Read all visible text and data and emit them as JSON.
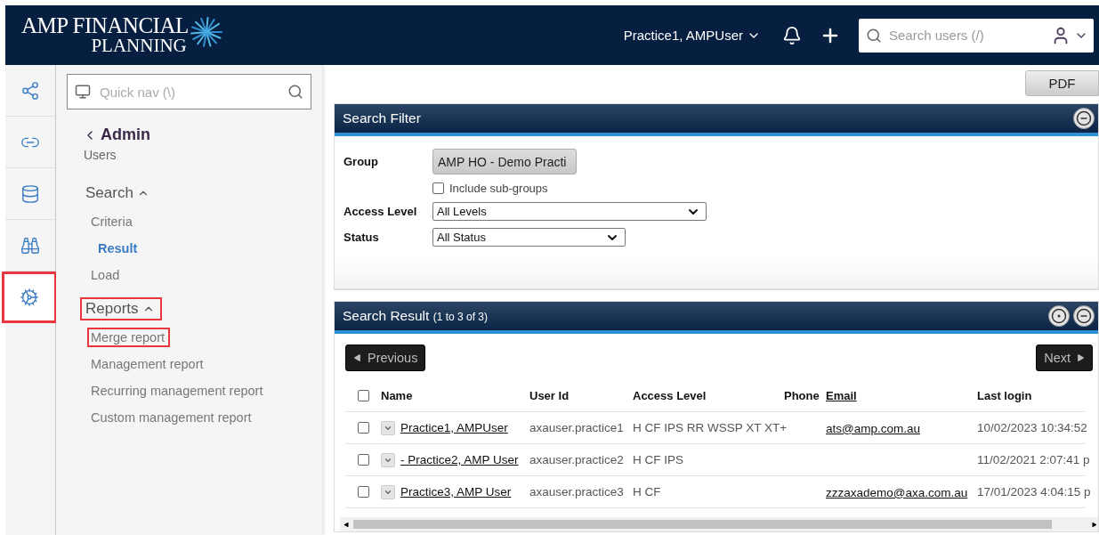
{
  "header": {
    "logo_line1": "AMP FINANCIAL",
    "logo_line2": "PLANNING",
    "user_menu": "Practice1, AMPUser",
    "search": {
      "placeholder": "Search users (/)"
    }
  },
  "rail": [
    {
      "kind": "network",
      "highlighted": false
    },
    {
      "kind": "link",
      "highlighted": false
    },
    {
      "kind": "database",
      "highlighted": false
    },
    {
      "kind": "binoculars",
      "highlighted": false
    },
    {
      "kind": "gears",
      "highlighted": true
    }
  ],
  "nav": {
    "quick_nav": {
      "placeholder": "Quick nav (\\)"
    },
    "back": "Admin",
    "subtitle": "Users",
    "sections": [
      {
        "title": "Search",
        "expanded": true,
        "highlighted": false,
        "items": [
          {
            "label": "Criteria",
            "selected": false,
            "highlighted": false
          },
          {
            "label": "Result",
            "selected": true,
            "highlighted": false
          },
          {
            "label": "Load",
            "selected": false,
            "highlighted": false
          }
        ]
      },
      {
        "title": "Reports",
        "expanded": true,
        "highlighted": true,
        "items": [
          {
            "label": "Merge report",
            "selected": false,
            "highlighted": true
          },
          {
            "label": "Management report",
            "selected": false,
            "highlighted": false
          },
          {
            "label": "Recurring management report",
            "selected": false,
            "highlighted": false
          },
          {
            "label": "Custom management report",
            "selected": false,
            "highlighted": false
          }
        ]
      }
    ]
  },
  "pdf_button": "PDF",
  "search_filter": {
    "title": "Search Filter",
    "group_label": "Group",
    "group_value": "AMP HO - Demo Practi",
    "include_subgroups": {
      "label": "Include sub-groups",
      "checked": false
    },
    "access_label": "Access Level",
    "access_value": "All Levels",
    "status_label": "Status",
    "status_value": "All Status"
  },
  "search_result": {
    "title": "Search Result",
    "count": "(1 to 3 of 3)",
    "previous": "Previous",
    "next": "Next",
    "select_all": {
      "checked": false
    },
    "columns": [
      "Name",
      "User Id",
      "Access Level",
      "Phone",
      "Email",
      "Last login"
    ],
    "rows": [
      {
        "checked": false,
        "name": "Practice1, AMPUser",
        "user_id": "axauser.practice1",
        "access": "H CF IPS RR WSSP XT XT+",
        "email": "ats@amp.com.au",
        "last_login": "10/02/2023 10:34:52"
      },
      {
        "checked": false,
        "name": " - Practice2, AMP User",
        "user_id": "axauser.practice2",
        "access": "H CF IPS",
        "email": "",
        "last_login": "11/02/2021 2:07:41 p"
      },
      {
        "checked": false,
        "name": "Practice3, AMP User",
        "user_id": "axauser.practice3",
        "access": "H CF",
        "email": "zzzaxademo@axa.com.au",
        "last_login": "17/01/2023 4:04:15 p"
      }
    ]
  }
}
